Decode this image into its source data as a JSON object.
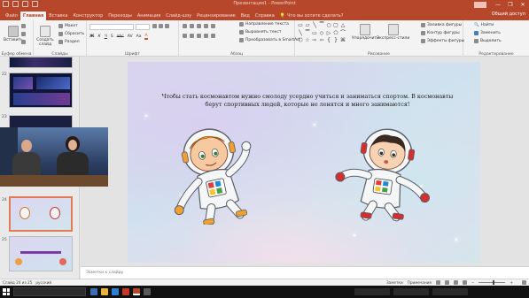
{
  "window": {
    "title": "Презентация1 - PowerPoint",
    "controls": [
      "—",
      "❐",
      "✕"
    ]
  },
  "tabs": [
    {
      "label": "Файл"
    },
    {
      "label": "Главная",
      "active": true
    },
    {
      "label": "Вставка"
    },
    {
      "label": "Конструктор"
    },
    {
      "label": "Переходы"
    },
    {
      "label": "Анимация"
    },
    {
      "label": "Слайд-шоу"
    },
    {
      "label": "Рецензирование"
    },
    {
      "label": "Вид"
    },
    {
      "label": "Справка"
    }
  ],
  "tell_me": "Что вы хотите сделать?",
  "share": "Общий доступ",
  "ribbon": {
    "clipboard": {
      "label": "Буфер обмена",
      "paste": "Вставить",
      "cut": "",
      "copy": "",
      "format": ""
    },
    "slides": {
      "label": "Слайды",
      "new_slide": "Создать слайд",
      "layout": "Макет",
      "reset": "Сбросить",
      "section": "Раздел"
    },
    "font": {
      "label": "Шрифт",
      "font_name": "",
      "font_size": ""
    },
    "paragraph": {
      "label": "Абзац",
      "text_direction": "Направление текста",
      "align_text": "Выровнять текст",
      "smartart": "Преобразовать в SmartArt"
    },
    "drawing": {
      "label": "Рисование",
      "arrange": "Упорядочить",
      "quick_styles": "Экспресс-стили",
      "fill": "Заливка фигуры",
      "outline": "Контур фигуры",
      "effects": "Эффекты фигуры"
    },
    "editing": {
      "label": "Редактирование",
      "find": "Найти",
      "replace": "Заменить",
      "select": "Выделить"
    }
  },
  "shape_glyphs": [
    "▭",
    "▱",
    "╲",
    "▔",
    "○",
    "▢",
    "△",
    "╲",
    "▔",
    "▭",
    "◇",
    "▷",
    "⬠",
    "⌒",
    "⬡",
    "☆",
    "⇨",
    "⇦",
    "{",
    "}",
    "⌘"
  ],
  "slide_pane": {
    "items": [
      {
        "num": "",
        "kind": "space"
      },
      {
        "num": "22",
        "kind": "space2"
      },
      {
        "num": "23",
        "kind": "space3"
      },
      {
        "num": "24",
        "kind": "astro",
        "selected": true
      },
      {
        "num": "25",
        "kind": "title_slide"
      }
    ]
  },
  "slide": {
    "text": "Чтобы стать космонавтом нужно  смолоду усердно учиться и заниматься спортом. В космонавты берут спортивных людей, которые не ленятся и много занимаются!"
  },
  "notes_placeholder": "Заметки к слайду",
  "status": {
    "left": "Слайд 24 из 25",
    "lang": "русский",
    "notes": "Заметки",
    "comments": "Примечания",
    "zoom": ""
  },
  "taskbar": {
    "search_placeholder": "",
    "time": "",
    "date": ""
  },
  "colors": {
    "accent": "#b7472a",
    "selected_thumb": "#e07b58"
  }
}
